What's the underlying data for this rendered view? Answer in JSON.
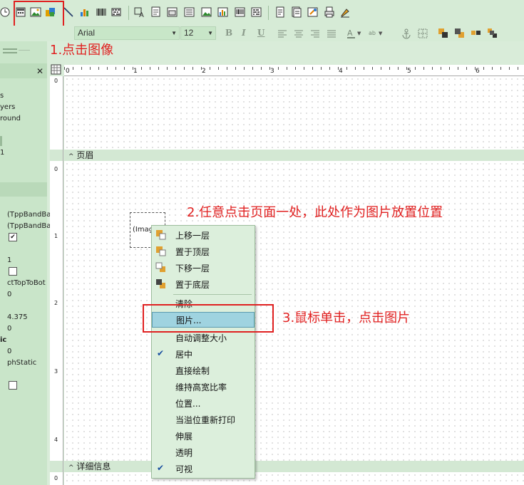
{
  "toolbar": {
    "font_name": "Arial",
    "font_size": "12",
    "icons": [
      "clock-icon",
      "calc-icon",
      "image-icon",
      "shape-icon",
      "line-icon",
      "chart-icon",
      "barcode-icon",
      "barcode2d-icon",
      "label-icon",
      "memo-icon",
      "subreport-icon",
      "dbimage-icon",
      "dbchart-icon",
      "dbbarcode-icon",
      "dbbarcode2d-icon",
      "page-icon",
      "page2-icon",
      "page3-icon",
      "print-icon",
      "highlighter-icon"
    ]
  },
  "left_panel": {
    "close_glyph": "✕",
    "lines": [
      "s",
      "yers",
      "round",
      "1",
      "(TppBandBa",
      "(TppBandBa",
      "1",
      "ctTopToBot",
      "0",
      "4.375",
      "0",
      "ic",
      "0",
      "phStatic"
    ]
  },
  "ruler": {
    "marks": [
      "0",
      "1",
      "2",
      "3",
      "4",
      "5",
      "6"
    ],
    "vmarks": [
      "0",
      "1",
      "2",
      "3",
      "4",
      "0"
    ]
  },
  "canvas": {
    "header_band": "页眉",
    "detail_band": "详细信息",
    "image_placeholder": "(Imag"
  },
  "context_menu": {
    "items": [
      {
        "label": "上移一层",
        "icon": "bring-forward-icon"
      },
      {
        "label": "置于顶层",
        "icon": "bring-to-front-icon"
      },
      {
        "label": "下移一层",
        "icon": "send-backward-icon"
      },
      {
        "label": "置于底层",
        "icon": "send-to-back-icon"
      },
      {
        "label": "清除",
        "icon": ""
      },
      {
        "label": "图片...",
        "icon": ""
      },
      {
        "label": "自动调整大小",
        "icon": ""
      },
      {
        "label": "居中",
        "icon": "check-icon"
      },
      {
        "label": "直接绘制",
        "icon": ""
      },
      {
        "label": "维持高宽比率",
        "icon": ""
      },
      {
        "label": "位置...",
        "icon": ""
      },
      {
        "label": "当溢位重新打印",
        "icon": ""
      },
      {
        "label": "伸展",
        "icon": ""
      },
      {
        "label": "透明",
        "icon": ""
      },
      {
        "label": "可视",
        "icon": "check-icon"
      }
    ],
    "check_glyph": "✔"
  },
  "annotations": {
    "step1": "1.点击图像",
    "step2": "2.任意点击页面一处，此处作为图片放置位置",
    "step3": "3.鼠标单击，点击图片"
  },
  "colors": {
    "annotation": "#e02020",
    "highlight": "#9fd3e0",
    "panel": "#c9e5c9"
  }
}
